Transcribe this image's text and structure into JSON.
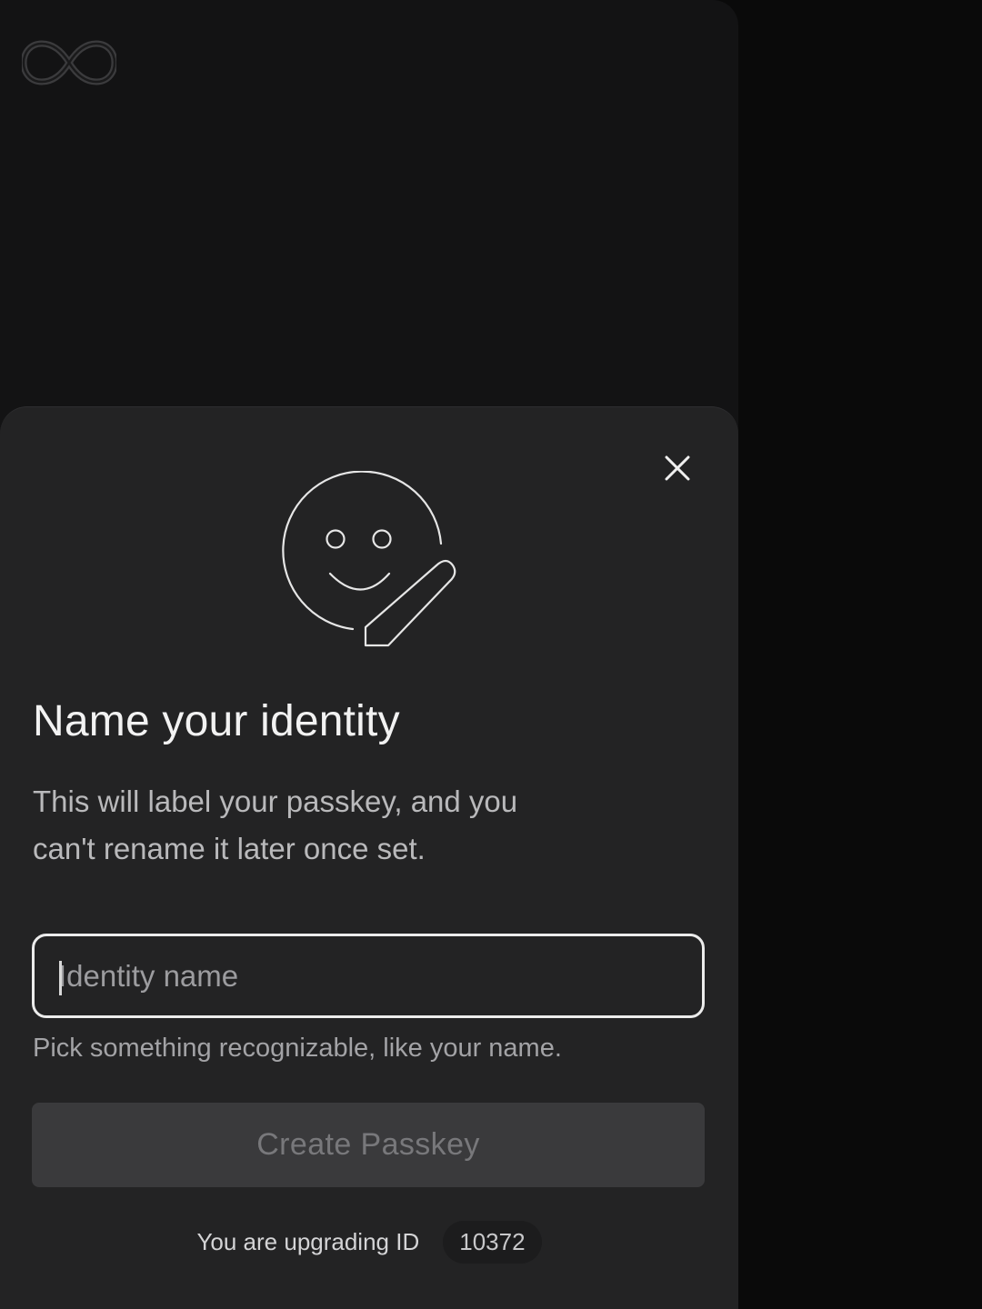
{
  "app": {
    "logo_icon": "infinity-logo-icon"
  },
  "dialog": {
    "close_icon": "close-icon",
    "illustration_icon": "smiley-pencil-icon",
    "title": "Name your identity",
    "description": "This will label your passkey, and you can't rename it later once set.",
    "input": {
      "value": "",
      "placeholder": "Identity name"
    },
    "hint": "Pick something recognizable, like your name.",
    "create_button_label": "Create Passkey",
    "create_button_disabled": true,
    "upgrade_text": "You are upgrading ID",
    "identity_number": "10372"
  },
  "colors": {
    "page_bg": "#0a0a0a",
    "app_bg": "#131314",
    "sheet_bg": "#232324",
    "input_border": "#ececec",
    "button_disabled_bg": "#3a3a3c",
    "button_disabled_text": "#78787b"
  }
}
